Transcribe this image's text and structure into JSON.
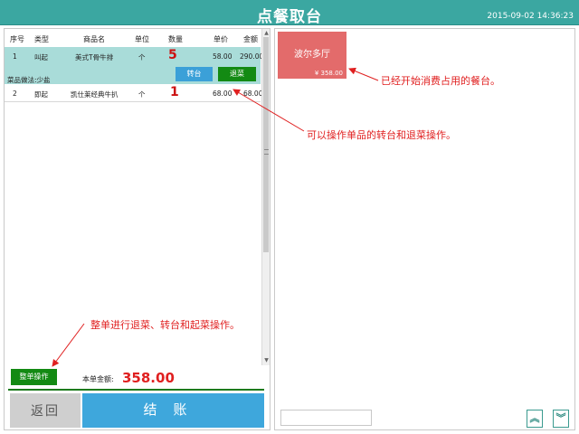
{
  "header": {
    "title": "点餐取台",
    "datetime": "2015-09-02 14:36:23"
  },
  "order": {
    "columns": [
      "序号",
      "类型",
      "商品名",
      "单位",
      "数量",
      "单价",
      "金额"
    ],
    "rows": [
      {
        "no": "1",
        "type": "叫起",
        "name": "美式T骨牛排",
        "unit": "个",
        "qty": "5",
        "price": "58.00",
        "amount": "290.00"
      },
      {
        "no": "2",
        "type": "即起",
        "name": "凯仕莱经典牛扒",
        "unit": "个",
        "qty": "1",
        "price": "68.00",
        "amount": "68.00"
      }
    ],
    "note": "菜品做法:少盐",
    "transfer_label": "转台",
    "return_label": "退菜",
    "whole_order_label": "整单操作",
    "total_label": "本单金额:",
    "total_value": "358.00",
    "back_label": "返回",
    "checkout_label": "结账"
  },
  "tables": [
    {
      "name": "波尔多厅",
      "amount": "¥ 358.00"
    }
  ],
  "annotations": {
    "occupied": "已经开始消费占用的餐台。",
    "item_ops": "可以操作单品的转台和退菜操作。",
    "whole_ops": "整单进行退菜、转台和起菜操作。"
  },
  "search": {
    "value": ""
  },
  "nav": {
    "up": "︽",
    "down": "︾"
  },
  "colors": {
    "header": "#3ba7a1",
    "accent_red": "#e02020",
    "green_button": "#138a13",
    "blue_button": "#3ea7dc",
    "table_busy": "#e36b6b"
  }
}
